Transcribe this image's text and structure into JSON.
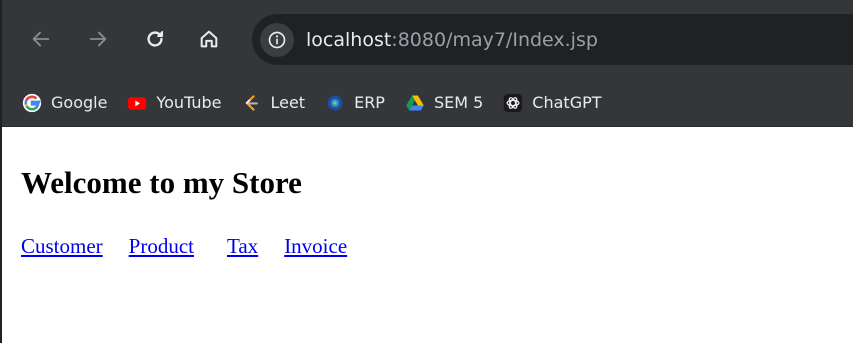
{
  "browser": {
    "address": {
      "host": "localhost",
      "path": ":8080/may7/Index.jsp"
    },
    "bookmarks": [
      {
        "label": "Google",
        "icon": "google-icon"
      },
      {
        "label": "YouTube",
        "icon": "youtube-icon"
      },
      {
        "label": "Leet",
        "icon": "leetcode-icon"
      },
      {
        "label": "ERP",
        "icon": "erp-icon"
      },
      {
        "label": "SEM 5",
        "icon": "google-drive-icon"
      },
      {
        "label": "ChatGPT",
        "icon": "chatgpt-icon"
      }
    ],
    "colors": {
      "toolbar": "#35363a",
      "omnibox": "#202124",
      "link": "#0000ee"
    }
  },
  "page": {
    "title": "Welcome to my Store",
    "links": [
      "Customer",
      "Product",
      "Tax",
      "Invoice"
    ]
  }
}
